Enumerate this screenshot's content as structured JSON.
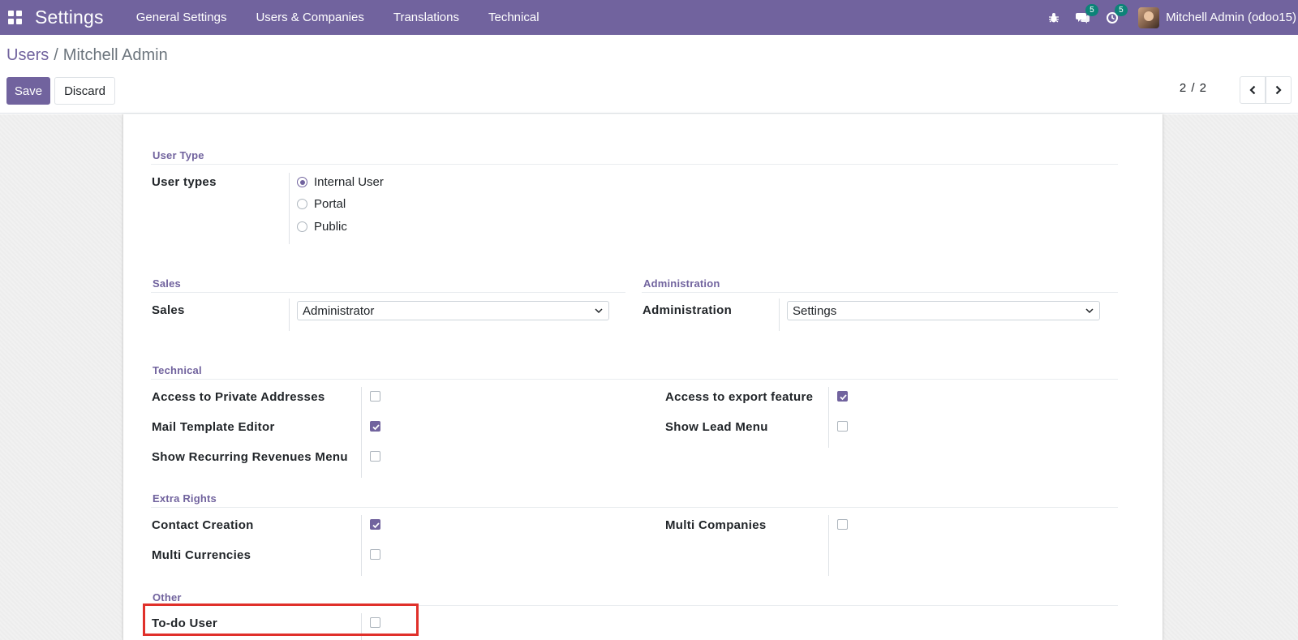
{
  "navbar": {
    "brand": "Settings",
    "menu": [
      "General Settings",
      "Users & Companies",
      "Translations",
      "Technical"
    ],
    "messages_count": "5",
    "activities_count": "5",
    "user_name": "Mitchell Admin (odoo15)"
  },
  "breadcrumb": {
    "parent": "Users",
    "separator": "/",
    "current": "Mitchell Admin"
  },
  "buttons": {
    "save": "Save",
    "discard": "Discard"
  },
  "pager": {
    "text": "2 / 2"
  },
  "user_type": {
    "section": "User Type",
    "label": "User types",
    "options": [
      {
        "label": "Internal User",
        "checked": true
      },
      {
        "label": "Portal",
        "checked": false
      },
      {
        "label": "Public",
        "checked": false
      }
    ]
  },
  "sales": {
    "section": "Sales",
    "label": "Sales",
    "value": "Administrator"
  },
  "administration": {
    "section": "Administration",
    "label": "Administration",
    "value": "Settings"
  },
  "technical": {
    "section": "Technical",
    "left": [
      {
        "label": "Access to Private Addresses",
        "checked": false
      },
      {
        "label": "Mail Template Editor",
        "checked": true
      },
      {
        "label": "Show Recurring Revenues Menu",
        "checked": false
      }
    ],
    "right": [
      {
        "label": "Access to export feature",
        "checked": true
      },
      {
        "label": "Show Lead Menu",
        "checked": false
      }
    ]
  },
  "extra_rights": {
    "section": "Extra Rights",
    "left": [
      {
        "label": "Contact Creation",
        "checked": true
      },
      {
        "label": "Multi Currencies",
        "checked": false
      }
    ],
    "right": [
      {
        "label": "Multi Companies",
        "checked": false
      }
    ]
  },
  "other": {
    "section": "Other",
    "items": [
      {
        "label": "To-do User",
        "checked": false
      }
    ]
  },
  "colors": {
    "brand": "#71639e",
    "badge": "#0d8378",
    "highlight": "#e0302a"
  }
}
